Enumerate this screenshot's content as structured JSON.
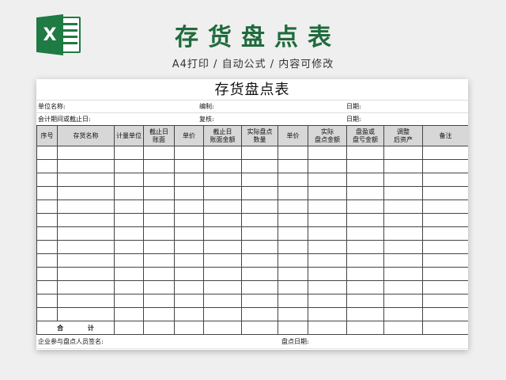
{
  "header": {
    "logo_letter": "X",
    "title": "存货盘点表",
    "subtitle": "A4打印 / 自动公式 / 内容可修改",
    "accent_color": "#1f7a43"
  },
  "sheet": {
    "title": "存货盘点表",
    "info": {
      "unit_name": "单位名称:",
      "compiler": "编制:",
      "date1": "日期:",
      "period": "会计期间或截止日:",
      "reviewer": "复核:",
      "date2": "日期:"
    },
    "columns": [
      "序号",
      "存货名称",
      "计量单位",
      "截止日\n账面",
      "单价",
      "截止日\n账面金额",
      "实际盘点\n数量",
      "单价",
      "实际\n盘点金额",
      "盘盈或\n盘亏金额",
      "调整\n后资产",
      "备注"
    ],
    "empty_row_count": 13,
    "total_label": "合 计",
    "footer": {
      "signers": "企业参与盘点人员签名:",
      "count_date": "盘点日期:"
    }
  }
}
